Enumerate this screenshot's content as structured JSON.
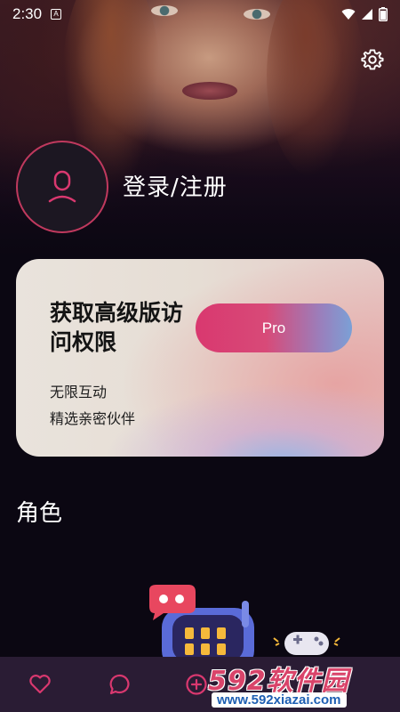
{
  "status_bar": {
    "time": "2:30",
    "notification_icon_text": "A"
  },
  "profile": {
    "login_label": "登录/注册"
  },
  "pro_card": {
    "title": "获取高级版访问权限",
    "button_label": "Pro",
    "features": [
      "无限互动",
      "精选亲密伙伴"
    ]
  },
  "section": {
    "title": "角色"
  },
  "watermark": {
    "brand": "592软件园",
    "url": "www.592xiazai.com"
  },
  "icons": {
    "settings": "gear-icon",
    "avatar": "user-icon",
    "nav": [
      "heart-icon",
      "chat-icon",
      "create-icon"
    ]
  },
  "colors": {
    "accent": "#d9386f",
    "nav_background": "#2a1c34",
    "background": "#0b0712"
  }
}
